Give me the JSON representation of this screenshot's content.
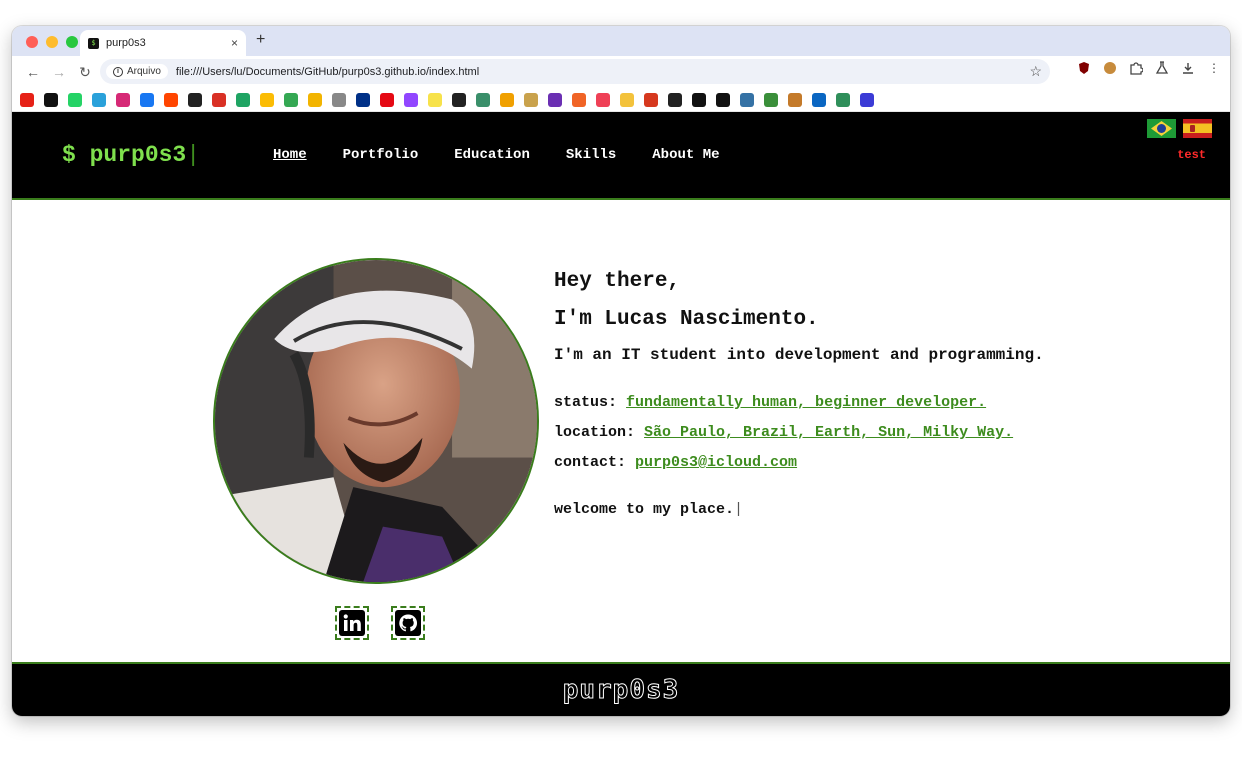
{
  "browser": {
    "tab_title": "purp0s3",
    "address_chip": "Arquivo",
    "url": "file:///Users/lu/Documents/GitHub/purp0s3.github.io/index.html",
    "new_tab_symbol": "+",
    "close_symbol": "×"
  },
  "bookmarks": [
    {
      "icon": "youtube-icon",
      "color": "#e62117"
    },
    {
      "icon": "x-icon",
      "color": "#111111"
    },
    {
      "icon": "whatsapp-icon",
      "color": "#25d366"
    },
    {
      "icon": "telegram-icon",
      "color": "#2aa1da"
    },
    {
      "icon": "instagram-icon",
      "color": "#d62976"
    },
    {
      "icon": "facebook-icon",
      "color": "#1877f2"
    },
    {
      "icon": "reddit-icon",
      "color": "#ff4500"
    },
    {
      "icon": "github-icon",
      "color": "#222222"
    },
    {
      "icon": "gmail-icon",
      "color": "#d93025"
    },
    {
      "icon": "drive-icon",
      "color": "#1fa463"
    },
    {
      "icon": "photos-icon",
      "color": "#fbbc04"
    },
    {
      "icon": "maps-icon",
      "color": "#34a853"
    },
    {
      "icon": "keep-icon",
      "color": "#f2b400"
    },
    {
      "icon": "apple-icon",
      "color": "#888888"
    },
    {
      "icon": "paypal-icon",
      "color": "#003087"
    },
    {
      "icon": "netflix-icon",
      "color": "#e50914"
    },
    {
      "icon": "twitch-icon",
      "color": "#9146ff"
    },
    {
      "icon": "notes-icon",
      "color": "#f7e24a"
    },
    {
      "icon": "bookmark-u-icon",
      "color": "#222222"
    },
    {
      "icon": "bookmark-star-icon",
      "color": "#3a8f6a"
    },
    {
      "icon": "chart-icon",
      "color": "#f0a000"
    },
    {
      "icon": "food-icon",
      "color": "#c9a24c"
    },
    {
      "icon": "purple-app-icon",
      "color": "#6b2fb3"
    },
    {
      "icon": "shop-icon",
      "color": "#f06426"
    },
    {
      "icon": "pocket-icon",
      "color": "#ef4056"
    },
    {
      "icon": "dh-icon",
      "color": "#f3c23b"
    },
    {
      "icon": "bars-icon",
      "color": "#d6381e"
    },
    {
      "icon": "wallet-icon",
      "color": "#222222"
    },
    {
      "icon": "adidas-icon",
      "color": "#111111"
    },
    {
      "icon": "bolt-icon",
      "color": "#111111"
    },
    {
      "icon": "python-icon",
      "color": "#3572a5"
    },
    {
      "icon": "leaf-icon",
      "color": "#3a8f3a"
    },
    {
      "icon": "grid-icon",
      "color": "#c47a2a"
    },
    {
      "icon": "linkedin-bm-icon",
      "color": "#0a66c2"
    },
    {
      "icon": "home-icon",
      "color": "#2f8f5a"
    },
    {
      "icon": "app-icon",
      "color": "#3b3bd6"
    }
  ],
  "site": {
    "logo_prompt": "$ purp0s3",
    "logo_cursor": "|",
    "nav": [
      "Home",
      "Portfolio",
      "Education",
      "Skills",
      "About Me"
    ],
    "active_nav": "Home",
    "test_label": "test",
    "greeting": "Hey there,",
    "name_line": "I'm Lucas Nascimento.",
    "subtitle": "I'm an IT student into development and programming.",
    "status_label": "status:",
    "status_value": "fundamentally human, beginner developer.",
    "location_label": "location:",
    "location_value": "São Paulo, Brazil, Earth, Sun, Milky Way.",
    "contact_label": "contact:",
    "contact_value": "purp0s3@icloud.com",
    "welcome": "welcome to my place.",
    "welcome_cursor": "|",
    "footer_logo": "purp0s3"
  },
  "colors": {
    "accent_green": "#7fe04d",
    "link_green": "#3d8c1e",
    "header_bg": "#000000",
    "test_red": "#ff2a2a"
  }
}
